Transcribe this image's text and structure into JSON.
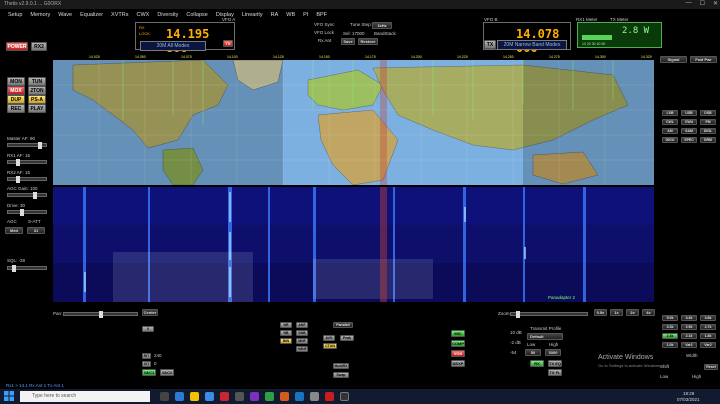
{
  "app": {
    "title": "Thetis v2.9.0.1 ... G0ORX"
  },
  "window_controls": [
    "—",
    "☐",
    "✕"
  ],
  "menu": [
    "Setup",
    "Memory",
    "Wave",
    "Equalizer",
    "XVTRs",
    "CWX",
    "Diversity",
    "Collapse",
    "Display",
    "Linearity",
    "RA",
    "WB",
    "PI",
    "BPF"
  ],
  "left_buttons": {
    "power": "POWER",
    "rx2": "RX2",
    "mon": "MON",
    "tun": "TUN",
    "mox": "MOX",
    "two_ton": "2TON",
    "dup": "DUP",
    "ps_a": "PS-A",
    "rec": "REC",
    "play": "PLAY"
  },
  "left_controls": {
    "master_af": "Master AF: 90",
    "rx1_af": "RX1 AF: 16",
    "rx1_af2": "RX2 AF: 15",
    "agc_gain": "AGC Gain: 100",
    "drive": "Drive: 30",
    "agc": "AGC",
    "step_att": "S-ATT",
    "agc_mode": "Med",
    "att_value": "31",
    "sql": "SQL: -28"
  },
  "vfo_a": {
    "label": "VFO A",
    "freq": "14.195 800",
    "mode": "20M All Modes",
    "sub_rx": "RX",
    "sub_lock": "LOCK"
  },
  "vfo_center": {
    "vfo_sync": "VFO Sync",
    "tune_step": "Tune Step:",
    "step_value": "1kHz",
    "vfo_lock": "VFO Lock",
    "step": "Sel: 17000",
    "band_stack": "BandStack",
    "rx_ant": "Rx Ant",
    "save": "Save",
    "restore": "Restore"
  },
  "vfo_b": {
    "label": "VFO B",
    "freq": "14.078 000",
    "mode": "20M Narrow Band Modes",
    "tx": "TX"
  },
  "meters": {
    "rx1_meter": "RX1 Meter",
    "tx_meter": "TX Meter",
    "tx_value": "2.8 W",
    "scale": "10  20  30  40  50"
  },
  "display": {
    "signal": "Signal",
    "fwd_pwr": "Fwd Pwr"
  },
  "map_labels": [],
  "waterfall_label": "Panadapter 2",
  "freq_scale": [
    "14.025",
    "14.050",
    "14.075",
    "14.100",
    "14.125",
    "14.150",
    "14.175",
    "14.200",
    "14.225",
    "14.250",
    "14.275",
    "14.300",
    "14.325"
  ],
  "right_mode_buttons": [
    "LSB",
    "USB",
    "DSB",
    "CWL",
    "CWU",
    "FM",
    "AM",
    "SAM",
    "DIGL",
    "DIGU",
    "SPEC",
    "DRM"
  ],
  "filter_buttons": [
    "5.0k",
    "4.4k",
    "3.8k",
    "3.3k",
    "2.9k",
    "2.7k",
    "2.4k",
    "2.1k",
    "1.8k",
    "1.0k",
    "Var1",
    "Var2"
  ],
  "filter_shift": {
    "width": "Width",
    "shift": "Shift",
    "low": "Low",
    "high": "High",
    "reset": "Reset"
  },
  "bottom": {
    "pan": "Pan:",
    "center": "Center",
    "nr": "NR",
    "anf": "ANF",
    "nb": "NB",
    "snb": "SNB",
    "bin": "BIN",
    "mnf": "MNF",
    "mnf_plus": "+MNF",
    "display_mode": "Panafall",
    "avg": "AVG",
    "peak": "Peak",
    "ctun": "CTUN",
    "zoom": "Zoom",
    "zoom_buttons": [
      "0.5x",
      "1x",
      "2x",
      "4x"
    ],
    "mic": "MIC",
    "comp": "COMP",
    "vox": "VOX",
    "dexp": "DEXP",
    "mic_db": "10 dB",
    "comp_db": "-2 dB",
    "vox_db": "-54",
    "transmit_profile": "Transmit Profile",
    "profile_value": "Default",
    "low": "Low",
    "high": "High",
    "low_val": "50",
    "high_val": "3000",
    "rx2_eq": "RX EQ",
    "tx_eq": "TX EQ",
    "tx_fl": "TX FL",
    "vac1": "VAC1",
    "vac2": "VAC2",
    "multi_rx": "MultiRX",
    "swap": "Swap",
    "rit": "RIT",
    "xit": "XIT",
    "rit_val": "240",
    "xit_val": "0",
    "zero_beat": "0 Beat",
    "cpu": "CPU",
    "activate_title": "Activate Windows",
    "activate_sub": "Go to Settings to activate Windows."
  },
  "status_bar": "Rx1 > 14.1    Rx Ant 1    Tx Ant 1",
  "taskbar": {
    "search_placeholder": "Type here to search",
    "time": "18:29",
    "date": "07/03/2021"
  },
  "colors": {
    "vfo_digits": "#ffb000",
    "map_ocean": "#7cb0e0",
    "waterfall_bg": "#0b0b5a",
    "cursor_line": "#c0403a"
  }
}
